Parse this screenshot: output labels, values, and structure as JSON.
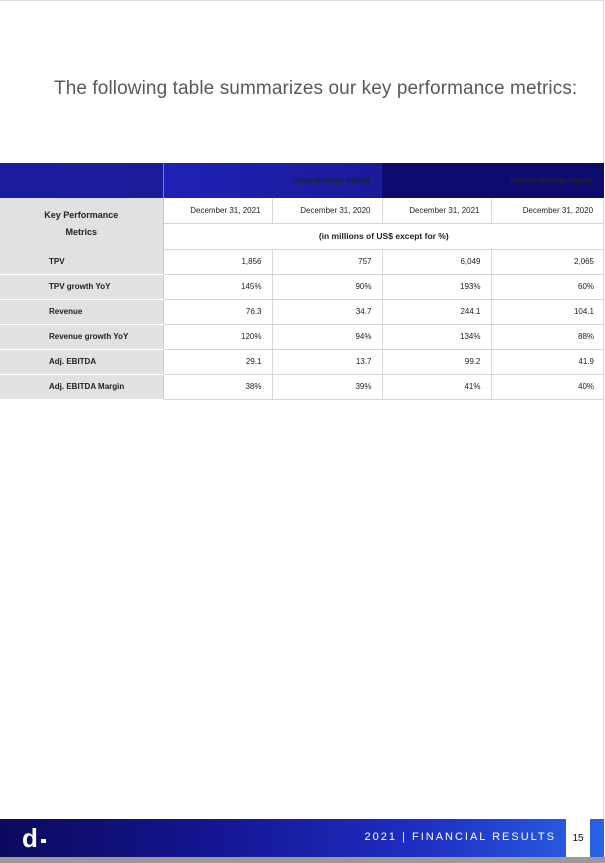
{
  "intro_text": "The following table summarizes our key performance metrics:",
  "table": {
    "group_headers": [
      "Three months ended",
      "Twelve months ended"
    ],
    "row_header_label_line1": "Key Performance",
    "row_header_label_line2": "Metrics",
    "dates": [
      "December 31, 2021",
      "December 31, 2020",
      "December 31, 2021",
      "December 31, 2020"
    ],
    "unit_note": "(in millions of US$ except for %)",
    "rows": [
      {
        "label": "TPV",
        "values": [
          "1,856",
          "757",
          "6,049",
          "2,065"
        ]
      },
      {
        "label": "TPV growth YoY",
        "values": [
          "145%",
          "90%",
          "193%",
          "60%"
        ]
      },
      {
        "label": "Revenue",
        "values": [
          "76.3",
          "34.7",
          "244.1",
          "104.1"
        ]
      },
      {
        "label": "Revenue growth YoY",
        "values": [
          "120%",
          "94%",
          "134%",
          "88%"
        ]
      },
      {
        "label": "Adj. EBITDA",
        "values": [
          "29.1",
          "13.7",
          "99.2",
          "41.9"
        ]
      },
      {
        "label": "Adj. EBITDA Margin",
        "values": [
          "38%",
          "39%",
          "41%",
          "40%"
        ]
      }
    ]
  },
  "footer": {
    "logo_text": "d",
    "title": "2021 | FINANCIAL RESULTS",
    "page_number": "15"
  },
  "colors": {
    "header_dark": "#0d0b6e",
    "header_blue": "#1f22b5",
    "label_bg": "#e1e1e1"
  }
}
